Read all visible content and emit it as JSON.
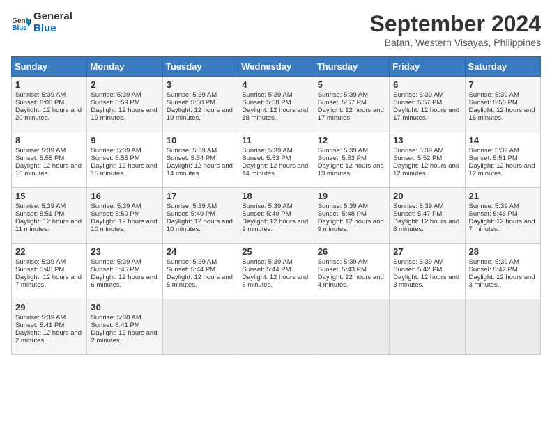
{
  "header": {
    "logo_line1": "General",
    "logo_line2": "Blue",
    "main_title": "September 2024",
    "subtitle": "Batan, Western Visayas, Philippines"
  },
  "calendar": {
    "days_of_week": [
      "Sunday",
      "Monday",
      "Tuesday",
      "Wednesday",
      "Thursday",
      "Friday",
      "Saturday"
    ],
    "weeks": [
      [
        {
          "day": "",
          "empty": true
        },
        {
          "day": "",
          "empty": true
        },
        {
          "day": "",
          "empty": true
        },
        {
          "day": "",
          "empty": true
        },
        {
          "day": "",
          "empty": true
        },
        {
          "day": "",
          "empty": true
        },
        {
          "day": "",
          "empty": true
        }
      ],
      [
        {
          "day": "1",
          "sunrise": "5:39 AM",
          "sunset": "6:00 PM",
          "daylight": "12 hours and 20 minutes."
        },
        {
          "day": "2",
          "sunrise": "5:39 AM",
          "sunset": "5:59 PM",
          "daylight": "12 hours and 19 minutes."
        },
        {
          "day": "3",
          "sunrise": "5:39 AM",
          "sunset": "5:58 PM",
          "daylight": "12 hours and 19 minutes."
        },
        {
          "day": "4",
          "sunrise": "5:39 AM",
          "sunset": "5:58 PM",
          "daylight": "12 hours and 18 minutes."
        },
        {
          "day": "5",
          "sunrise": "5:39 AM",
          "sunset": "5:57 PM",
          "daylight": "12 hours and 17 minutes."
        },
        {
          "day": "6",
          "sunrise": "5:39 AM",
          "sunset": "5:57 PM",
          "daylight": "12 hours and 17 minutes."
        },
        {
          "day": "7",
          "sunrise": "5:39 AM",
          "sunset": "5:56 PM",
          "daylight": "12 hours and 16 minutes."
        }
      ],
      [
        {
          "day": "8",
          "sunrise": "5:39 AM",
          "sunset": "5:55 PM",
          "daylight": "12 hours and 16 minutes."
        },
        {
          "day": "9",
          "sunrise": "5:39 AM",
          "sunset": "5:55 PM",
          "daylight": "12 hours and 15 minutes."
        },
        {
          "day": "10",
          "sunrise": "5:39 AM",
          "sunset": "5:54 PM",
          "daylight": "12 hours and 14 minutes."
        },
        {
          "day": "11",
          "sunrise": "5:39 AM",
          "sunset": "5:53 PM",
          "daylight": "12 hours and 14 minutes."
        },
        {
          "day": "12",
          "sunrise": "5:39 AM",
          "sunset": "5:53 PM",
          "daylight": "12 hours and 13 minutes."
        },
        {
          "day": "13",
          "sunrise": "5:39 AM",
          "sunset": "5:52 PM",
          "daylight": "12 hours and 12 minutes."
        },
        {
          "day": "14",
          "sunrise": "5:39 AM",
          "sunset": "5:51 PM",
          "daylight": "12 hours and 12 minutes."
        }
      ],
      [
        {
          "day": "15",
          "sunrise": "5:39 AM",
          "sunset": "5:51 PM",
          "daylight": "12 hours and 11 minutes."
        },
        {
          "day": "16",
          "sunrise": "5:39 AM",
          "sunset": "5:50 PM",
          "daylight": "12 hours and 10 minutes."
        },
        {
          "day": "17",
          "sunrise": "5:39 AM",
          "sunset": "5:49 PM",
          "daylight": "12 hours and 10 minutes."
        },
        {
          "day": "18",
          "sunrise": "5:39 AM",
          "sunset": "5:49 PM",
          "daylight": "12 hours and 9 minutes."
        },
        {
          "day": "19",
          "sunrise": "5:39 AM",
          "sunset": "5:48 PM",
          "daylight": "12 hours and 9 minutes."
        },
        {
          "day": "20",
          "sunrise": "5:39 AM",
          "sunset": "5:47 PM",
          "daylight": "12 hours and 8 minutes."
        },
        {
          "day": "21",
          "sunrise": "5:39 AM",
          "sunset": "5:46 PM",
          "daylight": "12 hours and 7 minutes."
        }
      ],
      [
        {
          "day": "22",
          "sunrise": "5:39 AM",
          "sunset": "5:46 PM",
          "daylight": "12 hours and 7 minutes."
        },
        {
          "day": "23",
          "sunrise": "5:39 AM",
          "sunset": "5:45 PM",
          "daylight": "12 hours and 6 minutes."
        },
        {
          "day": "24",
          "sunrise": "5:39 AM",
          "sunset": "5:44 PM",
          "daylight": "12 hours and 5 minutes."
        },
        {
          "day": "25",
          "sunrise": "5:39 AM",
          "sunset": "5:44 PM",
          "daylight": "12 hours and 5 minutes."
        },
        {
          "day": "26",
          "sunrise": "5:39 AM",
          "sunset": "5:43 PM",
          "daylight": "12 hours and 4 minutes."
        },
        {
          "day": "27",
          "sunrise": "5:39 AM",
          "sunset": "5:42 PM",
          "daylight": "12 hours and 3 minutes."
        },
        {
          "day": "28",
          "sunrise": "5:39 AM",
          "sunset": "5:42 PM",
          "daylight": "12 hours and 3 minutes."
        }
      ],
      [
        {
          "day": "29",
          "sunrise": "5:39 AM",
          "sunset": "5:41 PM",
          "daylight": "12 hours and 2 minutes."
        },
        {
          "day": "30",
          "sunrise": "5:38 AM",
          "sunset": "5:41 PM",
          "daylight": "12 hours and 2 minutes."
        },
        {
          "day": "",
          "empty": true
        },
        {
          "day": "",
          "empty": true
        },
        {
          "day": "",
          "empty": true
        },
        {
          "day": "",
          "empty": true
        },
        {
          "day": "",
          "empty": true
        }
      ]
    ]
  }
}
